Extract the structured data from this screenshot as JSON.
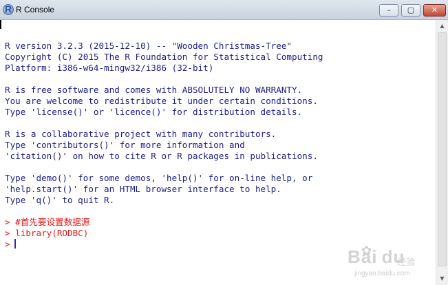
{
  "window": {
    "title": "R Console",
    "app_icon_letter": "R",
    "buttons": {
      "minimize": "–",
      "maximize": "▢",
      "close": "✕"
    }
  },
  "console": {
    "lines": [
      "R version 3.2.3 (2015-12-10) -- \"Wooden Christmas-Tree\"",
      "Copyright (C) 2015 The R Foundation for Statistical Computing",
      "Platform: i386-w64-mingw32/i386 (32-bit)",
      "R is free software and comes with ABSOLUTELY NO WARRANTY.",
      "You are welcome to redistribute it under certain conditions.",
      "Type 'license()' or 'licence()' for distribution details.",
      "R is a collaborative project with many contributors.",
      "Type 'contributors()' for more information and",
      "'citation()' on how to cite R or R packages in publications.",
      "Type 'demo()' for some demos, 'help()' for on-line help, or",
      "'help.start()' for an HTML browser interface to help.",
      "Type 'q()' to quit R."
    ],
    "commands": [
      "> #首先要设置数据源",
      "> library(RODBC)"
    ],
    "prompt": ">",
    "colors": {
      "output": "#1c1c8b",
      "input": "#e01b1b"
    }
  },
  "scrollbar": {
    "up_arrow": "▲",
    "down_arrow": "▼"
  },
  "watermark": {
    "logo": "Bai du",
    "cn": "经验",
    "url": "jingyan.baidu.com"
  }
}
